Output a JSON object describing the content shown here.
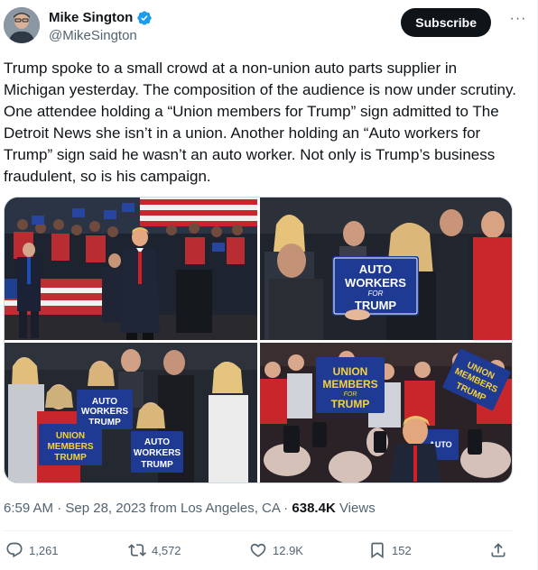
{
  "author": {
    "display_name": "Mike Sington",
    "handle": "@MikeSington"
  },
  "subscribe_label": "Subscribe",
  "more_label": "···",
  "tweet": {
    "text": "Trump spoke to a small crowd at a non-union auto parts supplier in Michigan yesterday. The composition of the audience is now under scrutiny. One attendee holding a “Union members for Trump” sign admitted to The Detroit News she isn’t in a union. Another holding an “Auto workers for Trump” sign said he wasn’t an auto worker. Not only is Trump’s business fraudulent, so is his campaign."
  },
  "media": {
    "signs": {
      "auto_workers": [
        "AUTO",
        "WORKERS",
        "FOR",
        "TRUMP"
      ],
      "union_members": [
        "UNION",
        "MEMBERS",
        "FOR",
        "TRUMP"
      ]
    }
  },
  "meta": {
    "time": "6:59 AM",
    "date": "Sep 28, 2023",
    "location": "from Los Angeles, CA",
    "views_count": "638.4K",
    "views_label": "Views",
    "separator": "·"
  },
  "actions": {
    "replies": "1,261",
    "reposts": "4,572",
    "likes": "12.9K",
    "bookmarks": "152"
  },
  "colors": {
    "verified_blue": "#1d9bf0",
    "text_primary": "#0f1419",
    "text_secondary": "#536471",
    "sign_blue": "#1f3a93",
    "sign_yellow": "#f7d23a"
  },
  "icons": [
    "verified-badge-icon",
    "more-icon",
    "reply-icon",
    "repost-icon",
    "like-icon",
    "bookmark-icon",
    "share-icon"
  ]
}
